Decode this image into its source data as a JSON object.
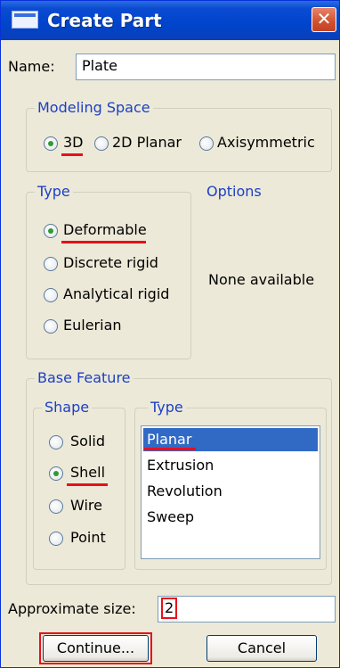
{
  "window": {
    "title": "Create Part",
    "close_glyph": "✕"
  },
  "name_field": {
    "label": "Name:",
    "value": "Plate"
  },
  "modeling_space": {
    "legend": "Modeling Space",
    "options": [
      "3D",
      "2D Planar",
      "Axisymmetric"
    ],
    "selected": "3D"
  },
  "type_group": {
    "legend": "Type",
    "options": [
      "Deformable",
      "Discrete rigid",
      "Analytical rigid",
      "Eulerian"
    ],
    "selected": "Deformable"
  },
  "options_group": {
    "legend": "Options",
    "message": "None available"
  },
  "base_feature": {
    "legend": "Base Feature",
    "shape": {
      "legend": "Shape",
      "options": [
        "Solid",
        "Shell",
        "Wire",
        "Point"
      ],
      "selected": "Shell"
    },
    "type": {
      "legend": "Type",
      "items": [
        "Planar",
        "Extrusion",
        "Revolution",
        "Sweep"
      ],
      "selected": "Planar"
    }
  },
  "approximate_size": {
    "label": "Approximate size:",
    "value": "2"
  },
  "buttons": {
    "continue": "Continue...",
    "cancel": "Cancel"
  },
  "colors": {
    "title_bar": "#0a4bd1",
    "accent_blue": "#1c3fc4",
    "highlight_red": "#e8101a",
    "selection": "#316ac5"
  }
}
